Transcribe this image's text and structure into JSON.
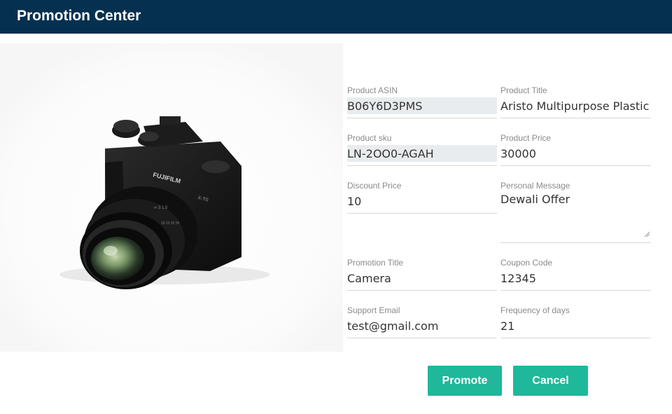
{
  "header": {
    "title": "Promotion Center"
  },
  "product_image": {
    "icon": "camera-photo",
    "brand_text": "FUJIFILM",
    "model_text": "X-T0"
  },
  "form": {
    "product_asin": {
      "label": "Product ASIN",
      "value": "B06Y6D3PMS"
    },
    "product_title": {
      "label": "Product Title",
      "value": "Aristo Multipurpose Plastic S"
    },
    "product_sku": {
      "label": "Product sku",
      "value": "LN-2OO0-AGAH"
    },
    "product_price": {
      "label": "Product Price",
      "value": "30000"
    },
    "discount_price": {
      "label": "Discount Price",
      "value": "10"
    },
    "personal_message": {
      "label": "Personal Message",
      "value": "Dewali Offer"
    },
    "promotion_title": {
      "label": "Promotion Title",
      "value": "Camera"
    },
    "coupon_code": {
      "label": "Coupon Code",
      "value": "12345"
    },
    "support_email": {
      "label": "Support Email",
      "value": "test@gmail.com"
    },
    "frequency_of_days": {
      "label": "Frequency of days",
      "value": "21"
    }
  },
  "actions": {
    "promote_label": "Promote",
    "cancel_label": "Cancel"
  },
  "colors": {
    "header_bg": "#05304f",
    "button_bg": "#1fb89b",
    "readonly_bg": "#e8ecef"
  }
}
